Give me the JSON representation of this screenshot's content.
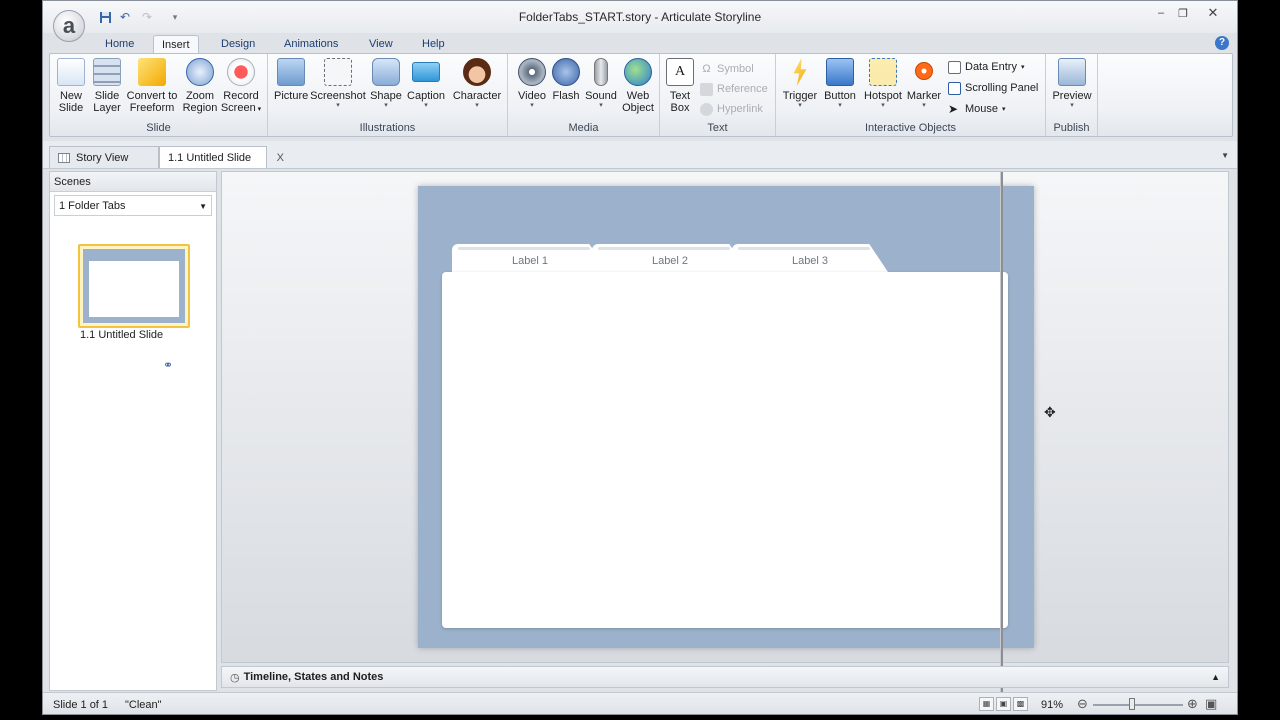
{
  "window": {
    "title": "FolderTabs_START.story - Articulate Storyline",
    "logo": "a"
  },
  "ribbon_tabs": [
    "Home",
    "Insert",
    "Design",
    "Animations",
    "View",
    "Help"
  ],
  "ribbon_groups": {
    "slide": {
      "label": "Slide",
      "buttons": [
        {
          "line1": "New",
          "line2": "Slide"
        },
        {
          "line1": "Slide",
          "line2": "Layer"
        },
        {
          "line1": "Convert to",
          "line2": "Freeform"
        },
        {
          "line1": "Zoom",
          "line2": "Region"
        },
        {
          "line1": "Record",
          "line2": "Screen"
        }
      ]
    },
    "illustrations": {
      "label": "Illustrations",
      "buttons": [
        "Picture",
        "Screenshot",
        "Shape",
        "Caption",
        "Character"
      ]
    },
    "media": {
      "label": "Media",
      "buttons": [
        {
          "line1": "Video",
          "line2": ""
        },
        {
          "line1": "Flash",
          "line2": ""
        },
        {
          "line1": "Sound",
          "line2": ""
        },
        {
          "line1": "Web",
          "line2": "Object"
        }
      ]
    },
    "text": {
      "label": "Text",
      "textbox": {
        "line1": "Text",
        "line2": "Box"
      },
      "small": [
        "Symbol",
        "Reference",
        "Hyperlink"
      ]
    },
    "interactive": {
      "label": "Interactive Objects",
      "buttons": [
        "Trigger",
        "Button",
        "Hotspot",
        "Marker"
      ],
      "small": [
        "Data Entry",
        "Scrolling Panel",
        "Mouse"
      ]
    },
    "publish": {
      "label": "Publish",
      "buttons": [
        "Preview"
      ]
    }
  },
  "doc_tabs": {
    "story_view": "Story View",
    "slide_tab": "1.1 Untitled Slide",
    "close": "X"
  },
  "scenes": {
    "header": "Scenes",
    "selected": "1 Folder Tabs",
    "thumb_label": "1.1 Untitled Slide"
  },
  "slide": {
    "tabs": [
      "Label 1",
      "Label 2",
      "Label 3"
    ]
  },
  "timeline": {
    "label": "Timeline, States and Notes"
  },
  "status": {
    "slide_count": "Slide 1 of 1",
    "theme": "\"Clean\"",
    "zoom": "91%"
  },
  "colors": {
    "slide_bg": "#9cb2cc",
    "accent": "#3a77c9",
    "selected_thumb": "#f0c441"
  }
}
